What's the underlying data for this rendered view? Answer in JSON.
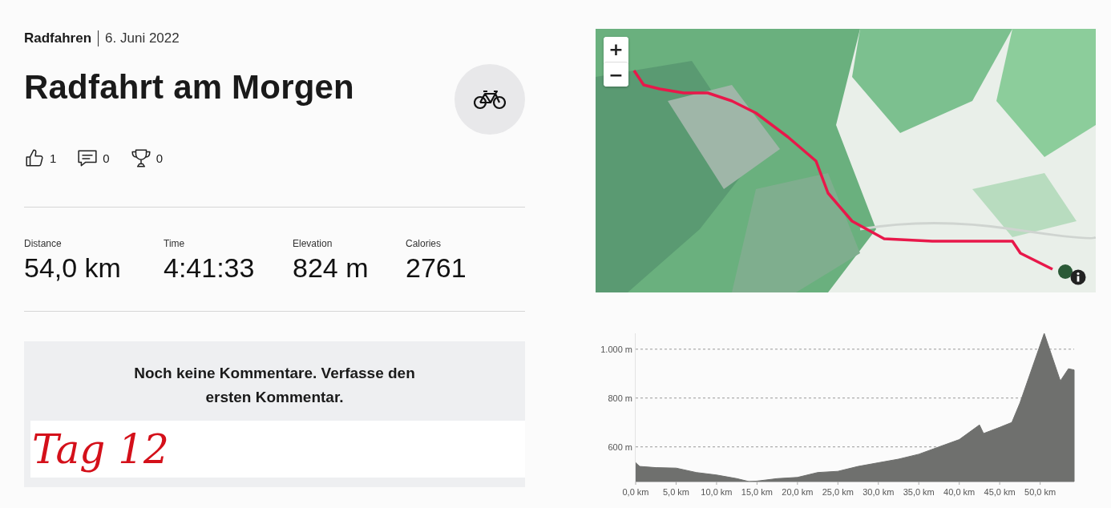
{
  "activity": {
    "sport": "Radfahren",
    "date": "6. Juni 2022",
    "title": "Radfahrt am Morgen"
  },
  "reactions": [
    {
      "kind": "kudos",
      "count": "1"
    },
    {
      "kind": "comments",
      "count": "0"
    },
    {
      "kind": "achievements",
      "count": "0"
    }
  ],
  "stats": [
    {
      "label": "Distance",
      "value": "54,0 km"
    },
    {
      "label": "Time",
      "value": "4:41:33"
    },
    {
      "label": "Elevation",
      "value": "824 m"
    },
    {
      "label": "Calories",
      "value": "2761"
    }
  ],
  "comments": {
    "empty_message": "Noch keine Kommentare. Verfasse den ersten Kommentar."
  },
  "annotation": {
    "text": "Tag 12"
  },
  "map": {
    "kind": "picture",
    "zoom_in": "+",
    "zoom_out": "−"
  },
  "elevation": {
    "chart_data": {
      "type": "area",
      "x": [
        0,
        0.5,
        2.5,
        5,
        7.5,
        10,
        12.5,
        14,
        15,
        17.5,
        20,
        22.5,
        25,
        27.5,
        30,
        32.5,
        35,
        37.5,
        40,
        42.5,
        43,
        45,
        46.5,
        47.5,
        50.5,
        52.5,
        53.5,
        54.2
      ],
      "series": [
        {
          "color": "#6f706e",
          "values": [
            535,
            520,
            515,
            513,
            495,
            485,
            470,
            458,
            460,
            470,
            475,
            495,
            500,
            520,
            535,
            550,
            570,
            600,
            630,
            690,
            655,
            680,
            700,
            780,
            1065,
            870,
            920,
            915
          ]
        }
      ],
      "xlim": [
        0,
        54.2
      ],
      "ylim": [
        458,
        1065
      ],
      "grid": true,
      "xticks": [
        {
          "value": 0,
          "label": "0,0 km"
        },
        {
          "value": 5,
          "label": "5,0 km"
        },
        {
          "value": 10,
          "label": "10,0 km"
        },
        {
          "value": 15,
          "label": "15,0 km"
        },
        {
          "value": 20,
          "label": "20,0 km"
        },
        {
          "value": 25,
          "label": "25,0 km"
        },
        {
          "value": 30,
          "label": "30,0 km"
        },
        {
          "value": 35,
          "label": "35,0 km"
        },
        {
          "value": 40,
          "label": "40,0 km"
        },
        {
          "value": 45,
          "label": "45,0 km"
        },
        {
          "value": 50,
          "label": "50,0 km"
        }
      ],
      "yticks": [
        {
          "value": 600,
          "label": "600 m"
        },
        {
          "value": 800,
          "label": "800 m"
        },
        {
          "value": 1000,
          "label": "1.000 m"
        }
      ]
    }
  }
}
